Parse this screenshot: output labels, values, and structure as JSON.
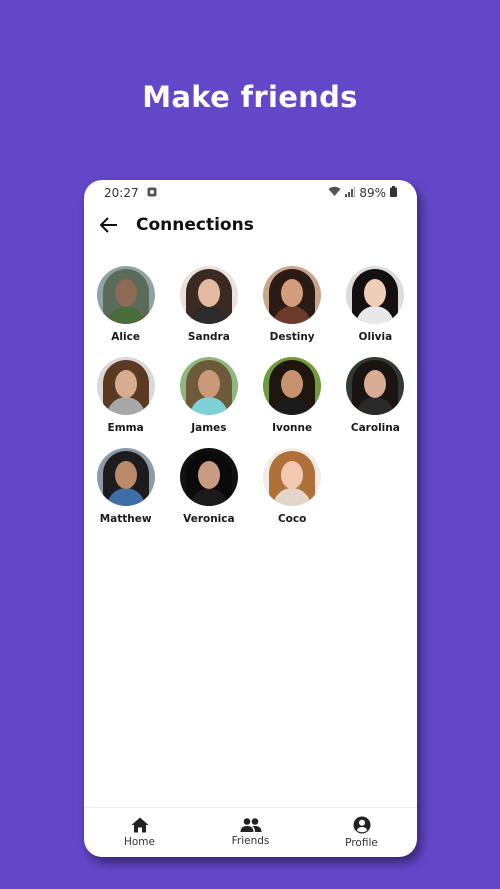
{
  "promo": {
    "headline": "Make friends"
  },
  "status_bar": {
    "time": "20:27",
    "battery": "89%"
  },
  "header": {
    "title": "Connections"
  },
  "colors": {
    "background": "#6347c9",
    "surface": "#ffffff",
    "text": "#111111"
  },
  "friends": [
    {
      "name": "Alice",
      "bg": "#8fa3a6",
      "hair": "#5b6b5a",
      "skin": "#8a6b55",
      "shirt": "#4a6b3a"
    },
    {
      "name": "Sandra",
      "bg": "#e9e2dc",
      "hair": "#3b2a22",
      "skin": "#e4b9a2",
      "shirt": "#2b2b2b"
    },
    {
      "name": "Destiny",
      "bg": "#caa58e",
      "hair": "#2a1b14",
      "skin": "#d39c7c",
      "shirt": "#6b3a2a"
    },
    {
      "name": "Olivia",
      "bg": "#dcdcdc",
      "hair": "#151010",
      "skin": "#f0cdb8",
      "shirt": "#e8e8e8"
    },
    {
      "name": "Emma",
      "bg": "#d8d8d8",
      "hair": "#5a3a22",
      "skin": "#d8ad8f",
      "shirt": "#a8a8a8"
    },
    {
      "name": "James",
      "bg": "#8fb87c",
      "hair": "#6d5a3a",
      "skin": "#c99a7a",
      "shirt": "#7fd1d8"
    },
    {
      "name": "Ivonne",
      "bg": "#6f9b3a",
      "hair": "#1f160f",
      "skin": "#c9926f",
      "shirt": "#1b1b1b"
    },
    {
      "name": "Carolina",
      "bg": "#2f3a33",
      "hair": "#1a1512",
      "skin": "#d8ad93",
      "shirt": "#2a2a2a"
    },
    {
      "name": "Matthew",
      "bg": "#8a9aa8",
      "hair": "#1c1c1c",
      "skin": "#b98a6a",
      "shirt": "#3f6ea6"
    },
    {
      "name": "Veronica",
      "bg": "#111111",
      "hair": "#0a0a0a",
      "skin": "#c89c80",
      "shirt": "#1a1a1a"
    },
    {
      "name": "Coco",
      "bg": "#f1ece6",
      "hair": "#b0703a",
      "skin": "#f0c9b0",
      "shirt": "#e3d6c8"
    }
  ],
  "nav": [
    {
      "label": "Home",
      "icon": "home-icon"
    },
    {
      "label": "Friends",
      "icon": "people-icon"
    },
    {
      "label": "Profile",
      "icon": "account-circle-icon"
    }
  ]
}
